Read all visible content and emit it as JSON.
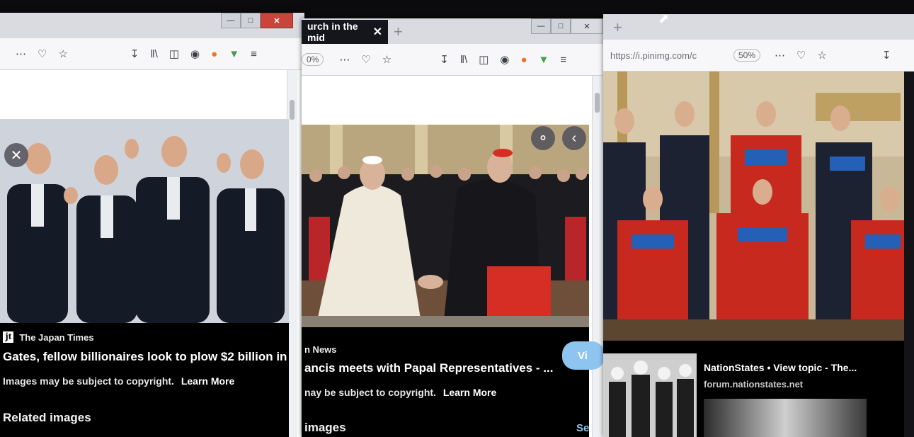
{
  "windows": {
    "left": {
      "source": "The Japan Times",
      "source_logo": "jt",
      "headline": "Gates, fellow billionaires look to plow $2 billion in",
      "copyright_notice": "Images may be subject to copyright.",
      "learn_more": "Learn More",
      "related_heading": "Related images"
    },
    "middle": {
      "tab_title": "urch in the mid",
      "zoom": "0%",
      "source": "n News",
      "headline": "ancis meets with Papal Representatives - ...",
      "copyright_notice": "nay be subject to copyright.",
      "learn_more": "Learn More",
      "related_heading": " images",
      "see_more": "Se",
      "visit_label": "Vi"
    },
    "right": {
      "url": "https://i.pinimg.com/c",
      "zoom": "50%",
      "related_title": "NationStates • View topic - The...",
      "related_domain": "forum.nationstates.net"
    }
  },
  "toolbar_icons": [
    "menu-dots-icon",
    "pocket-icon",
    "star-icon",
    "download-icon",
    "library-icon",
    "sidebar-icon",
    "account-icon",
    "extension-t-icon",
    "extension-arrow-icon",
    "overflow-menu-icon"
  ],
  "colors": {
    "accent_orange": "#e8772e",
    "accent_green": "#43a047",
    "visit_blue": "#8ec5f0",
    "close_red": "#c9453c"
  }
}
